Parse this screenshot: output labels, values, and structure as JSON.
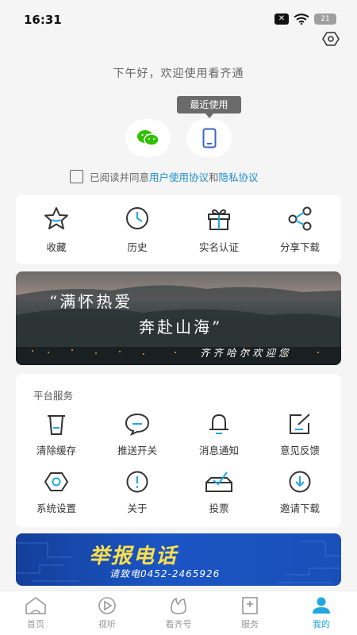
{
  "status": {
    "time": "16:31",
    "battery": "21"
  },
  "greeting": "下午好，欢迎使用看齐通",
  "recent_tag": "最近使用",
  "agreement": {
    "prefix": "已阅读并同意",
    "user_agreement": "用户使用协议",
    "and": "和",
    "privacy": "隐私协议"
  },
  "quick": [
    {
      "label": "收藏",
      "icon": "star-icon"
    },
    {
      "label": "历史",
      "icon": "clock-icon"
    },
    {
      "label": "实名认证",
      "icon": "gift-icon"
    },
    {
      "label": "分享下载",
      "icon": "share-icon"
    }
  ],
  "banner": {
    "line1": "“满怀热爱",
    "line2": "奔赴山海”",
    "line3": "齐齐哈尔欢迎您"
  },
  "services": {
    "title": "平台服务",
    "items": [
      {
        "label": "清除缓存",
        "icon": "trash-icon"
      },
      {
        "label": "推送开关",
        "icon": "chat-bubble-icon"
      },
      {
        "label": "消息通知",
        "icon": "bell-icon"
      },
      {
        "label": "意见反馈",
        "icon": "edit-icon"
      },
      {
        "label": "系统设置",
        "icon": "hexagon-settings-icon"
      },
      {
        "label": "关于",
        "icon": "info-icon"
      },
      {
        "label": "投票",
        "icon": "ballot-box-icon"
      },
      {
        "label": "邀请下载",
        "icon": "download-circle-icon"
      }
    ]
  },
  "hotline": {
    "title": "举报电话",
    "sub": "请致电0452-2465926"
  },
  "tabs": [
    {
      "label": "首页",
      "icon": "home-icon"
    },
    {
      "label": "视听",
      "icon": "play-icon"
    },
    {
      "label": "看齐号",
      "icon": "flame-icon"
    },
    {
      "label": "服务",
      "icon": "service-icon"
    },
    {
      "label": "我的",
      "icon": "user-icon",
      "active": true
    }
  ],
  "colors": {
    "accent": "#1fa7e0",
    "link": "#1b8ed0",
    "wechat": "#2dc100",
    "hotline_yellow": "#ffe04a"
  }
}
